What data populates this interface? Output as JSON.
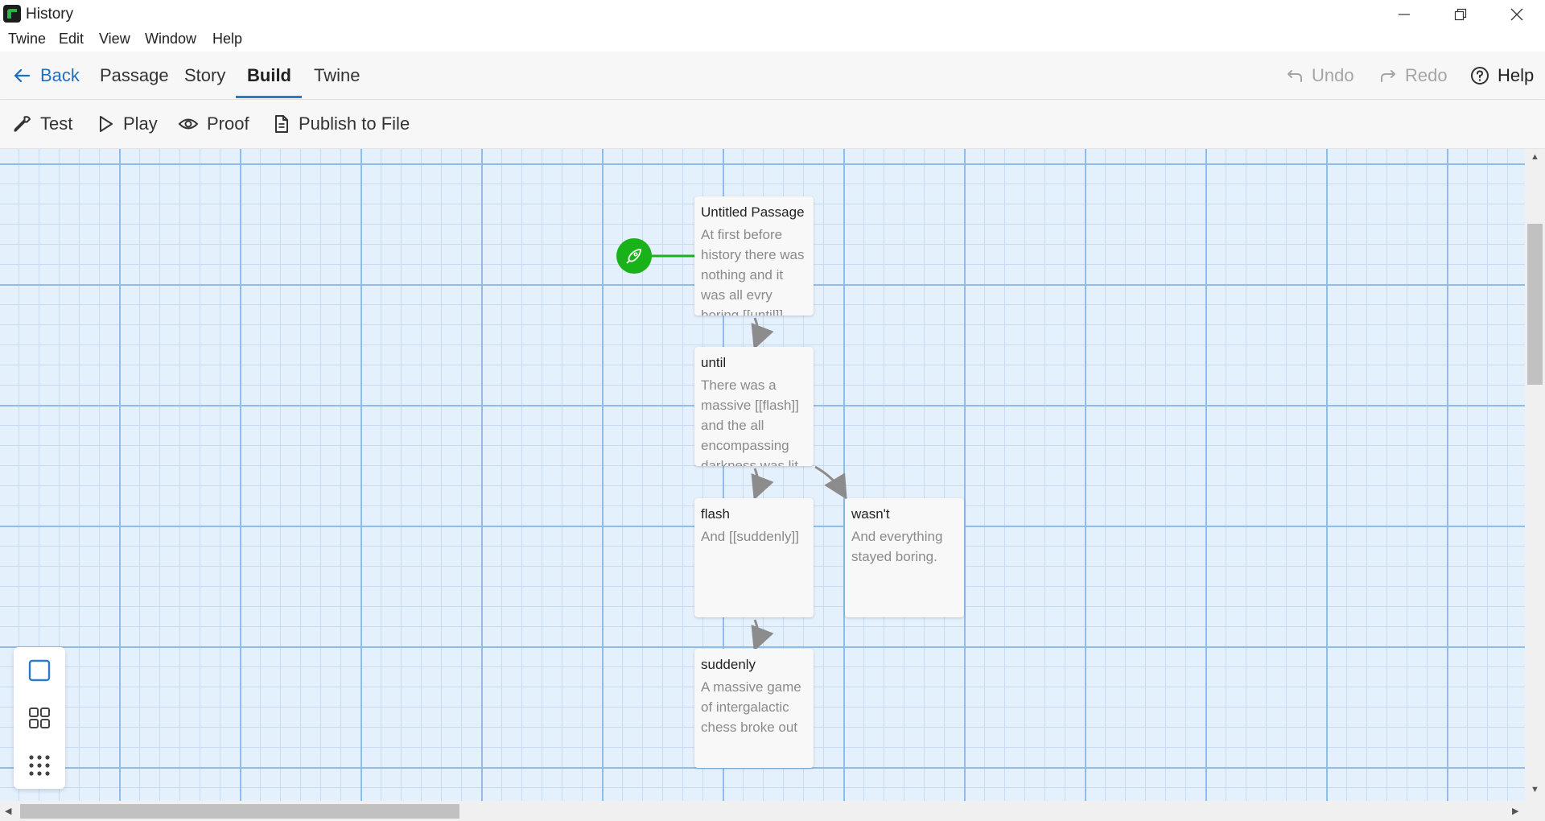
{
  "window": {
    "title": "History"
  },
  "menu": [
    "Twine",
    "Edit",
    "View",
    "Window",
    "Help"
  ],
  "tabs": {
    "back": "Back",
    "items": [
      "Passage",
      "Story",
      "Build",
      "Twine"
    ],
    "active": "Build",
    "undo": "Undo",
    "redo": "Redo",
    "help": "Help"
  },
  "build_tools": [
    "Test",
    "Play",
    "Proof",
    "Publish to File"
  ],
  "passages": [
    {
      "title": "Untitled Passage",
      "excerpt": "At first before history there was nothing and it was all evry boring [[until]]",
      "start": true
    },
    {
      "title": "until",
      "excerpt": "There was a massive [[flash]] and the all encompassing darkness was lit"
    },
    {
      "title": "flash",
      "excerpt": "And [[suddenly]]"
    },
    {
      "title": "wasn't",
      "excerpt": "And everything stayed boring."
    },
    {
      "title": "suddenly",
      "excerpt": "A massive game of intergalactic chess broke out"
    }
  ],
  "zoom_levels": [
    "zoom-100-icon",
    "zoom-60-icon",
    "zoom-30-icon"
  ],
  "colors": {
    "accent": "#2a7bc9",
    "start": "#19b319",
    "grid": "#e5f0fd"
  }
}
